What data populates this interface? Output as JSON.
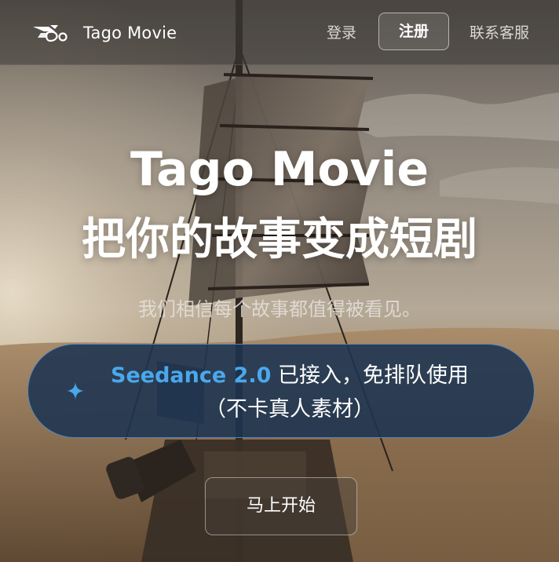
{
  "header": {
    "logo_icon": "tago-logo-icon",
    "brand": "Tago Movie",
    "nav": {
      "login": "登录",
      "register": "注册",
      "support": "联系客服"
    }
  },
  "hero": {
    "title": "Tago Movie",
    "subtitle": "把你的故事变成短剧",
    "tagline": "我们相信每个故事都值得被看见。"
  },
  "announcement": {
    "icon": "sparkle-icon",
    "highlight": "Seedance 2.0",
    "text": " 已接入，免排队使用",
    "note": "（不卡真人素材）",
    "highlight_color": "#4aa8ec"
  },
  "cta": {
    "label": "马上开始"
  },
  "colors": {
    "accent": "#4aa8ec",
    "pill_bg": "#1c3452",
    "pill_border": "#6ea0d7"
  }
}
